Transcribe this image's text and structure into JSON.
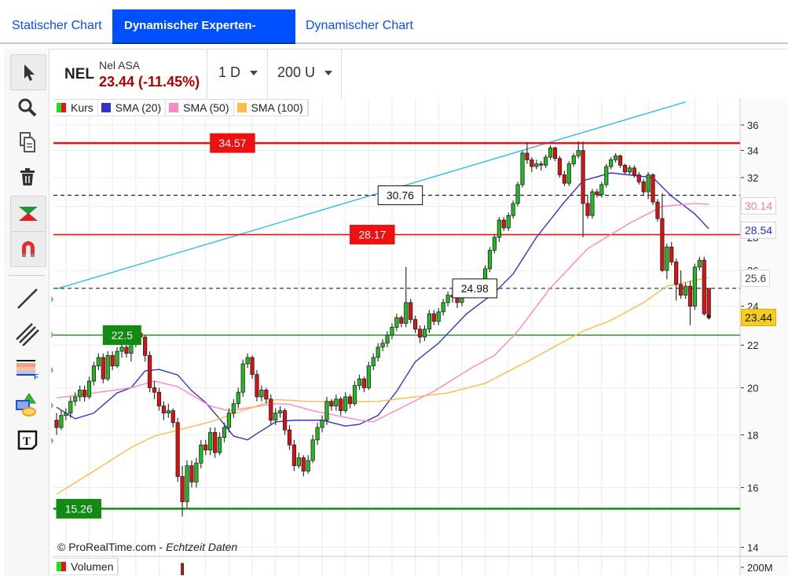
{
  "tabs": [
    {
      "label": "Statischer Chart",
      "active": false
    },
    {
      "label": "Dynamischer Experten-Chart",
      "active": true
    },
    {
      "label": "Dynamischer Chart",
      "active": false
    }
  ],
  "toolbar": {
    "tools": [
      "pointer-icon",
      "zoom-icon",
      "copy-icon",
      "trash-icon",
      "auto-trend-icon",
      "magnet-icon",
      "line-icon",
      "parallel-lines-icon",
      "fibonacci-icon",
      "shapes-icon",
      "text-icon"
    ]
  },
  "header": {
    "symbol": "NEL",
    "name": "Nel ASA",
    "price_change": "23.44 (-11.45%)",
    "interval": "1 D",
    "units": "200 U"
  },
  "legend": {
    "items": [
      {
        "label": "Kurs",
        "color": "#22cc22",
        "color2": "#ee1111"
      },
      {
        "label": "SMA (20)",
        "color": "#3333cc"
      },
      {
        "label": "SMA (50)",
        "color": "#ff88c0"
      },
      {
        "label": "SMA (100)",
        "color": "#ffbb44"
      }
    ],
    "volume_label": "Volumen"
  },
  "credit": {
    "source": "© ProRealTime.com - ",
    "realtime": "Echtzeit Daten"
  },
  "chart_data": {
    "type": "candlestick",
    "y_scale": "log",
    "ylim": [
      13.3,
      38
    ],
    "y_ticks": [
      14,
      16,
      18,
      20,
      22,
      24,
      26,
      28,
      30,
      32,
      34,
      36
    ],
    "volume_tick": "200M",
    "grid": true,
    "colors": {
      "up": "#22bb22",
      "down": "#dd1111",
      "sma20": "#3333cc",
      "sma50": "#ff88c0",
      "sma100": "#ffbb44",
      "trend": "#22b8f0"
    },
    "ohlc": [
      [
        18.6,
        18.9,
        18.0,
        18.3
      ],
      [
        18.3,
        19.0,
        18.2,
        18.8
      ],
      [
        18.8,
        19.1,
        18.6,
        18.9
      ],
      [
        18.9,
        19.6,
        18.7,
        19.4
      ],
      [
        19.4,
        19.8,
        19.2,
        19.6
      ],
      [
        19.6,
        20.1,
        19.4,
        19.9
      ],
      [
        19.9,
        20.1,
        19.4,
        19.6
      ],
      [
        19.6,
        20.5,
        19.5,
        20.3
      ],
      [
        20.3,
        21.2,
        20.1,
        21.0
      ],
      [
        21.0,
        21.6,
        20.8,
        21.4
      ],
      [
        21.4,
        21.6,
        20.2,
        20.4
      ],
      [
        20.4,
        21.7,
        20.3,
        21.5
      ],
      [
        21.5,
        21.7,
        20.8,
        21.0
      ],
      [
        21.0,
        21.9,
        20.9,
        21.7
      ],
      [
        21.7,
        22.1,
        21.4,
        21.9
      ],
      [
        21.9,
        22.1,
        21.4,
        21.6
      ],
      [
        21.6,
        22.3,
        21.2,
        22.1
      ],
      [
        22.1,
        22.8,
        21.9,
        22.6
      ],
      [
        22.6,
        22.8,
        22.1,
        22.4
      ],
      [
        22.4,
        22.5,
        21.2,
        21.5
      ],
      [
        21.5,
        21.7,
        19.8,
        20.0
      ],
      [
        20.0,
        20.3,
        19.5,
        19.8
      ],
      [
        19.8,
        20.0,
        19.0,
        19.2
      ],
      [
        19.2,
        19.4,
        18.6,
        18.9
      ],
      [
        18.9,
        19.3,
        18.7,
        19.0
      ],
      [
        19.0,
        19.1,
        18.3,
        18.5
      ],
      [
        18.5,
        18.7,
        16.2,
        16.4
      ],
      [
        16.4,
        16.8,
        15.0,
        15.5
      ],
      [
        15.5,
        17.0,
        15.3,
        16.8
      ],
      [
        16.8,
        17.0,
        16.0,
        16.2
      ],
      [
        16.2,
        17.1,
        16.0,
        16.9
      ],
      [
        16.9,
        17.8,
        16.7,
        17.6
      ],
      [
        17.6,
        17.8,
        17.2,
        17.4
      ],
      [
        17.4,
        18.3,
        17.2,
        18.1
      ],
      [
        18.1,
        18.3,
        17.1,
        17.3
      ],
      [
        17.3,
        18.1,
        17.2,
        17.9
      ],
      [
        17.9,
        18.5,
        17.7,
        18.3
      ],
      [
        18.3,
        19.1,
        18.1,
        18.9
      ],
      [
        18.9,
        19.5,
        18.7,
        19.3
      ],
      [
        19.3,
        20.0,
        19.1,
        19.8
      ],
      [
        19.8,
        21.3,
        19.6,
        21.1
      ],
      [
        21.1,
        21.6,
        20.9,
        21.4
      ],
      [
        21.4,
        21.5,
        20.4,
        20.6
      ],
      [
        20.6,
        20.8,
        19.4,
        19.6
      ],
      [
        19.6,
        20.1,
        19.4,
        19.9
      ],
      [
        19.9,
        20.0,
        19.3,
        19.5
      ],
      [
        19.5,
        19.7,
        18.4,
        18.6
      ],
      [
        18.6,
        19.1,
        18.4,
        18.9
      ],
      [
        18.9,
        19.2,
        18.7,
        19.0
      ],
      [
        19.0,
        19.1,
        18.0,
        18.2
      ],
      [
        18.2,
        18.4,
        17.4,
        17.6
      ],
      [
        17.6,
        17.8,
        16.6,
        16.8
      ],
      [
        16.8,
        17.3,
        16.7,
        17.1
      ],
      [
        17.1,
        17.2,
        16.4,
        16.6
      ],
      [
        16.6,
        17.2,
        16.5,
        17.0
      ],
      [
        17.0,
        18.0,
        16.9,
        17.8
      ],
      [
        17.8,
        18.5,
        17.6,
        18.3
      ],
      [
        18.3,
        18.8,
        18.1,
        18.6
      ],
      [
        18.6,
        19.6,
        18.4,
        19.4
      ],
      [
        19.4,
        19.5,
        19.0,
        19.2
      ],
      [
        19.2,
        19.7,
        19.0,
        19.5
      ],
      [
        19.5,
        19.6,
        18.8,
        19.0
      ],
      [
        19.0,
        19.8,
        18.9,
        19.6
      ],
      [
        19.6,
        19.7,
        19.1,
        19.3
      ],
      [
        19.3,
        20.3,
        19.2,
        20.1
      ],
      [
        20.1,
        20.6,
        19.9,
        20.4
      ],
      [
        20.4,
        20.5,
        19.8,
        20.0
      ],
      [
        20.0,
        21.2,
        19.9,
        21.0
      ],
      [
        21.0,
        21.6,
        20.8,
        21.4
      ],
      [
        21.4,
        22.1,
        21.2,
        21.9
      ],
      [
        21.9,
        22.3,
        21.7,
        22.1
      ],
      [
        22.1,
        22.7,
        21.9,
        22.5
      ],
      [
        22.5,
        23.1,
        22.3,
        22.9
      ],
      [
        22.9,
        23.6,
        22.7,
        23.4
      ],
      [
        23.4,
        23.5,
        22.9,
        23.1
      ],
      [
        23.1,
        26.2,
        22.9,
        24.2
      ],
      [
        24.2,
        24.4,
        23.1,
        23.3
      ],
      [
        23.3,
        23.5,
        22.6,
        22.8
      ],
      [
        22.8,
        23.0,
        22.1,
        22.4
      ],
      [
        22.4,
        23.0,
        22.2,
        22.8
      ],
      [
        22.8,
        23.8,
        22.6,
        23.6
      ],
      [
        23.6,
        23.8,
        23.0,
        23.2
      ],
      [
        23.2,
        23.9,
        23.0,
        23.7
      ],
      [
        23.7,
        24.4,
        23.5,
        24.2
      ],
      [
        24.2,
        24.8,
        24.0,
        24.6
      ],
      [
        24.6,
        24.9,
        24.2,
        24.5
      ],
      [
        24.5,
        24.6,
        23.9,
        24.2
      ],
      [
        24.2,
        25.1,
        24.0,
        24.9
      ],
      [
        24.9,
        25.3,
        24.7,
        25.1
      ],
      [
        25.1,
        25.2,
        24.6,
        24.8
      ],
      [
        24.8,
        25.2,
        24.6,
        25.0
      ],
      [
        25.0,
        25.5,
        24.8,
        25.3
      ],
      [
        25.3,
        26.3,
        25.1,
        26.1
      ],
      [
        26.1,
        27.4,
        25.9,
        27.2
      ],
      [
        27.2,
        28.2,
        27.0,
        28.0
      ],
      [
        28.0,
        29.3,
        27.7,
        29.1
      ],
      [
        29.1,
        29.3,
        28.4,
        28.6
      ],
      [
        28.6,
        29.6,
        28.4,
        29.4
      ],
      [
        29.4,
        30.4,
        29.2,
        30.2
      ],
      [
        30.2,
        31.7,
        30.0,
        31.5
      ],
      [
        31.5,
        34.0,
        31.3,
        33.8
      ],
      [
        33.8,
        34.6,
        33.0,
        33.3
      ],
      [
        33.3,
        33.5,
        32.4,
        32.8
      ],
      [
        32.8,
        33.3,
        32.6,
        33.0
      ],
      [
        33.0,
        33.2,
        32.5,
        32.9
      ],
      [
        32.9,
        33.7,
        32.7,
        33.5
      ],
      [
        33.5,
        34.4,
        33.3,
        34.2
      ],
      [
        34.2,
        34.3,
        33.2,
        33.4
      ],
      [
        33.4,
        33.6,
        32.0,
        32.2
      ],
      [
        32.2,
        32.5,
        31.4,
        31.6
      ],
      [
        31.6,
        33.2,
        31.4,
        33.0
      ],
      [
        33.0,
        33.8,
        32.8,
        33.6
      ],
      [
        33.6,
        34.7,
        33.4,
        34.0
      ],
      [
        34.0,
        34.7,
        28.0,
        30.2
      ],
      [
        30.2,
        30.8,
        29.2,
        29.4
      ],
      [
        29.4,
        31.2,
        29.2,
        31.0
      ],
      [
        31.0,
        31.2,
        30.6,
        30.8
      ],
      [
        30.8,
        31.7,
        30.6,
        31.5
      ],
      [
        31.5,
        33.0,
        31.3,
        32.8
      ],
      [
        32.8,
        33.5,
        32.6,
        33.3
      ],
      [
        33.3,
        33.8,
        33.1,
        33.6
      ],
      [
        33.6,
        33.7,
        32.7,
        32.9
      ],
      [
        32.9,
        33.0,
        32.2,
        32.4
      ],
      [
        32.4,
        32.9,
        32.2,
        32.7
      ],
      [
        32.7,
        32.9,
        32.0,
        32.2
      ],
      [
        32.2,
        32.4,
        31.5,
        31.7
      ],
      [
        31.7,
        31.9,
        30.8,
        31.0
      ],
      [
        31.0,
        32.4,
        30.5,
        32.2
      ],
      [
        32.2,
        32.3,
        30.1,
        30.3
      ],
      [
        30.3,
        30.5,
        29.0,
        29.2
      ],
      [
        29.2,
        30.9,
        25.9,
        26.0
      ],
      [
        26.0,
        27.6,
        25.5,
        27.4
      ],
      [
        27.4,
        27.7,
        26.3,
        26.5
      ],
      [
        26.5,
        26.7,
        24.3,
        25.2
      ],
      [
        25.2,
        26.0,
        24.4,
        24.6
      ],
      [
        24.6,
        25.3,
        24.4,
        25.1
      ],
      [
        25.1,
        25.4,
        23.0,
        24.0
      ],
      [
        24.0,
        26.4,
        23.8,
        26.2
      ],
      [
        26.2,
        26.8,
        26.0,
        26.6
      ],
      [
        26.6,
        26.8,
        23.5,
        23.6
      ],
      [
        24.98,
        24.98,
        23.3,
        23.44
      ]
    ],
    "sma": [
      {
        "name": "SMA (20)",
        "last": "28.54",
        "points": [
          [
            0,
            19.15
          ],
          [
            4,
            18.66
          ],
          [
            8,
            18.9
          ],
          [
            13,
            19.77
          ],
          [
            16,
            20.0
          ],
          [
            19,
            20.77
          ],
          [
            22,
            20.84
          ],
          [
            26,
            20.58
          ],
          [
            29,
            19.87
          ],
          [
            32,
            19.35
          ],
          [
            35,
            18.66
          ],
          [
            38,
            17.95
          ],
          [
            41,
            17.8
          ],
          [
            43,
            18.05
          ],
          [
            47,
            18.53
          ],
          [
            51,
            18.6
          ],
          [
            57,
            18.6
          ],
          [
            62,
            18.36
          ],
          [
            65,
            18.43
          ],
          [
            69,
            18.8
          ],
          [
            73,
            19.84
          ],
          [
            77,
            21.2
          ],
          [
            82,
            22.1
          ],
          [
            88,
            23.6
          ],
          [
            94,
            24.74
          ],
          [
            98,
            25.8
          ],
          [
            103,
            28.0
          ],
          [
            109,
            30.3
          ],
          [
            113,
            31.78
          ],
          [
            119,
            32.34
          ],
          [
            128,
            32.0
          ],
          [
            132,
            30.7
          ],
          [
            137,
            29.5
          ],
          [
            140,
            28.54
          ]
        ]
      },
      {
        "name": "SMA (50)",
        "last": "30.14",
        "points": [
          [
            0,
            19.55
          ],
          [
            8,
            19.77
          ],
          [
            16,
            20.0
          ],
          [
            21,
            20.3
          ],
          [
            26,
            20.05
          ],
          [
            33,
            19.2
          ],
          [
            37,
            19.0
          ],
          [
            47,
            19.3
          ],
          [
            50,
            19.27
          ],
          [
            55,
            19.0
          ],
          [
            60,
            18.8
          ],
          [
            65,
            18.6
          ],
          [
            68,
            18.53
          ],
          [
            81,
            19.84
          ],
          [
            89,
            20.9
          ],
          [
            94,
            21.5
          ],
          [
            99,
            22.7
          ],
          [
            106,
            25.0
          ],
          [
            114,
            27.3
          ],
          [
            123,
            28.9
          ],
          [
            130,
            30.0
          ],
          [
            137,
            30.2
          ],
          [
            140,
            30.14
          ]
        ]
      },
      {
        "name": "SMA (100)",
        "last": "25.6",
        "points": [
          [
            0,
            15.76
          ],
          [
            8,
            16.6
          ],
          [
            16,
            17.5
          ],
          [
            21,
            17.95
          ],
          [
            33,
            18.53
          ],
          [
            40,
            19.0
          ],
          [
            47,
            19.48
          ],
          [
            54,
            19.4
          ],
          [
            63,
            19.38
          ],
          [
            69,
            19.4
          ],
          [
            84,
            19.77
          ],
          [
            92,
            20.2
          ],
          [
            101,
            21.2
          ],
          [
            113,
            22.7
          ],
          [
            119,
            23.25
          ],
          [
            126,
            24.2
          ],
          [
            131,
            25.1
          ],
          [
            140,
            25.6
          ]
        ]
      }
    ],
    "last_price": "23.44",
    "trendline": [
      [
        0,
        24.95
      ],
      [
        135,
        37.9
      ]
    ],
    "levels": [
      {
        "value": 34.57,
        "label": "34.57",
        "style": "red-thick",
        "label_at": 33
      },
      {
        "value": 30.76,
        "label": "30.76",
        "style": "dashed",
        "label_at": 69
      },
      {
        "value": 28.17,
        "label": "28.17",
        "style": "red",
        "label_at": 63
      },
      {
        "value": 24.98,
        "label": "24.98",
        "style": "dashed",
        "label_at": 85
      },
      {
        "value": 22.5,
        "label": "22.5",
        "style": "green",
        "label_at": 10
      },
      {
        "value": 15.26,
        "label": "15.26",
        "style": "green-thick",
        "label_at": 0
      }
    ]
  }
}
